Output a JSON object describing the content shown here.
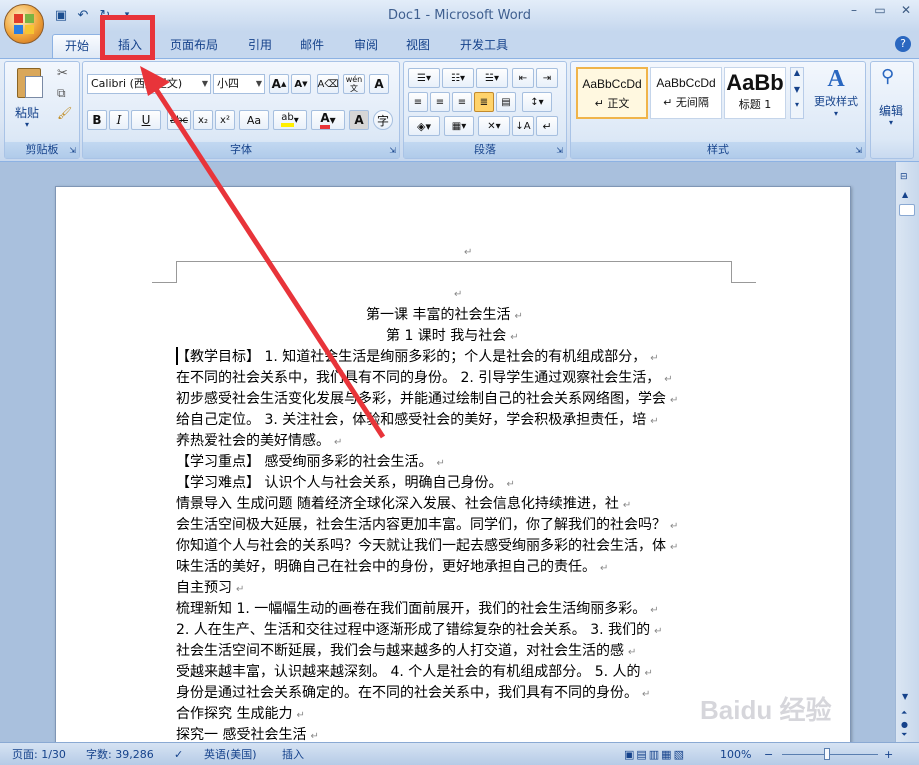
{
  "window": {
    "title": "Doc1 - Microsoft Word",
    "min": "–",
    "restore": "▭",
    "close": "✕"
  },
  "qat": {
    "save_icon": "save-icon",
    "undo_icon": "undo-icon",
    "redo_icon": "redo-icon"
  },
  "tabs": [
    {
      "label": "开始",
      "active": true
    },
    {
      "label": "插入",
      "active": false
    },
    {
      "label": "页面布局",
      "active": false
    },
    {
      "label": "引用",
      "active": false
    },
    {
      "label": "邮件",
      "active": false
    },
    {
      "label": "审阅",
      "active": false
    },
    {
      "label": "视图",
      "active": false
    },
    {
      "label": "开发工具",
      "active": false
    }
  ],
  "help": "?",
  "ribbon": {
    "clipboard": {
      "label": "剪贴板",
      "paste": "粘贴"
    },
    "font": {
      "label": "字体",
      "font_name": "Calibri (西文正文)",
      "font_size": "小四",
      "buttons": [
        "B",
        "I",
        "U",
        "abc",
        "x₂",
        "x²",
        "Aa"
      ],
      "wen": "wén",
      "zi": "文"
    },
    "paragraph": {
      "label": "段落"
    },
    "styles": {
      "label": "样式",
      "items": [
        {
          "preview": "AaBbCcDd",
          "name": "↵ 正文"
        },
        {
          "preview": "AaBbCcDd",
          "name": "↵ 无间隔"
        },
        {
          "preview": "AaBb",
          "name": "标题 1"
        }
      ],
      "change_styles": "更改样式"
    },
    "editing": {
      "label": "编辑"
    }
  },
  "document": {
    "lines": [
      {
        "text": "第一课  丰富的社会生活",
        "indent": 190
      },
      {
        "text": "第 1 课时  我与社会",
        "indent": 210
      },
      {
        "text": "【教学目标】   1. 知道社会生活是绚丽多彩的；个人是社会的有机组成部分，",
        "indent": 0
      },
      {
        "text": "在不同的社会关系中，我们具有不同的身份。  2. 引导学生通过观察社会生活，",
        "indent": 0
      },
      {
        "text": "初步感受社会生活变化发展与多彩，并能通过绘制自己的社会关系网络图，学会",
        "indent": 0
      },
      {
        "text": "给自己定位。   3. 关注社会，体验和感受社会的美好，学会积极承担责任，培",
        "indent": 0
      },
      {
        "text": "养热爱社会的美好情感。",
        "indent": 0
      },
      {
        "text": "【学习重点】   感受绚丽多彩的社会生活。",
        "indent": 0
      },
      {
        "text": "【学习难点】   认识个人与社会关系，明确自己身份。",
        "indent": 0
      },
      {
        "text": "   情景导入  生成问题    随着经济全球化深入发展、社会信息化持续推进，社",
        "indent": 0
      },
      {
        "text": "会生活空间极大延展，社会生活内容更加丰富。同学们，你了解我们的社会吗？",
        "indent": 0
      },
      {
        "text": "你知道个人与社会的关系吗？今天就让我们一起去感受绚丽多彩的社会生活，体",
        "indent": 0
      },
      {
        "text": "味生活的美好，明确自己在社会中的身份，更好地承担自己的责任。",
        "indent": 0
      },
      {
        "text": "自主预习",
        "indent": 0
      },
      {
        "text": "梳理新知   1. 一幅幅生动的画卷在我们面前展开，我们的社会生活绚丽多彩。",
        "indent": 0
      },
      {
        "text": "2. 人在生产、生活和交往过程中逐渐形成了错综复杂的社会关系。   3. 我们的",
        "indent": 0
      },
      {
        "text": "社会生活空间不断延展，我们会与越来越多的人打交道，对社会生活的感",
        "indent": 0
      },
      {
        "text": "受越来越丰富，认识越来越深刻。   4. 个人是社会的有机组成部分。   5. 人的",
        "indent": 0
      },
      {
        "text": "身份是通过社会关系确定的。在不同的社会关系中，我们具有不同的身份。",
        "indent": 0
      },
      {
        "text": "合作探究  生成能力",
        "indent": 0
      },
      {
        "text": "探究一  感受社会生活",
        "indent": 0
      }
    ]
  },
  "status": {
    "page": "页面: 1/30",
    "words": "字数: 39,286",
    "language": "英语(美国)",
    "mode": "插入",
    "zoom": "100%",
    "zoom_minus": "−",
    "zoom_plus": "+"
  },
  "watermark": "Baidu 经验",
  "annotation": {
    "color": "#e8343a"
  }
}
